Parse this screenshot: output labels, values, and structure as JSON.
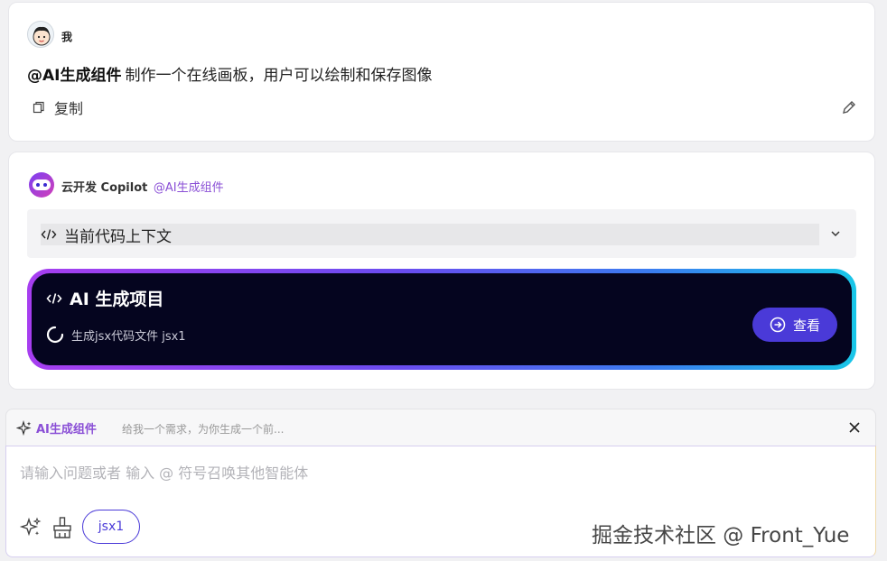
{
  "user_message": {
    "author": "我",
    "mention": "@AI生成组件",
    "text": "制作一个在线画板，用户可以绘制和保存图像",
    "copy_label": "复制"
  },
  "assistant": {
    "name": "云开发 Copilot",
    "agent_tag": "@AI生成组件",
    "context_label": "当前代码上下文",
    "project": {
      "title": "AI 生成项目",
      "status": "生成jsx代码文件 jsx1",
      "view_label": "查看"
    }
  },
  "composer": {
    "agent_name": "AI生成组件",
    "agent_desc": "给我一个需求，为你生成一个前...",
    "placeholder": "请输入问题或者 输入 @ 符号召唤其他智能体",
    "value": "",
    "file_chip": "jsx1"
  },
  "watermark": "掘金技术社区 @ Front_Yue",
  "colors": {
    "accent": "#4a3ad8",
    "agent": "#8a4fd6",
    "card_bg": "#05051f"
  }
}
